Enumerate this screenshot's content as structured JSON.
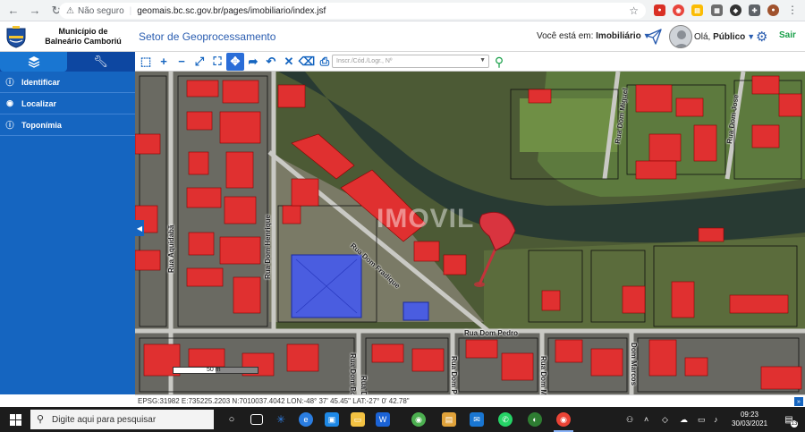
{
  "browser": {
    "security_label": "Não seguro",
    "url": "geomais.bc.sc.gov.br/pages/imobiliario/index.jsf"
  },
  "header": {
    "municipality_line1": "Município de",
    "municipality_line2": "Balneário Camboriú",
    "section_title": "Setor de Geoprocessamento",
    "voce_label": "Você está em:",
    "voce_value": "Imobiliário",
    "greeting_label": "Olá,",
    "greeting_user": "Público",
    "logout_label": "Sair"
  },
  "sidebar": {
    "tabs": [
      {
        "icon": "layers-icon"
      },
      {
        "icon": "wrench-icon"
      }
    ],
    "items": [
      {
        "label": "Identificar",
        "icon": "info-icon"
      },
      {
        "label": "Localizar",
        "icon": "map-pin-icon"
      },
      {
        "label": "Toponímia",
        "icon": "info-icon"
      }
    ]
  },
  "toolbar": {
    "search_placeholder": "Inscr./Cód./Logr., Nº"
  },
  "map": {
    "street_labels": [
      "Rua Dom Fradique",
      "Rua Dom Henrique",
      "Rua Aquidabã",
      "Rua Dom Pedro",
      "Rua Dom Miguel",
      "Rua Dom Jose",
      "Rua Dom Bos",
      "Rua Dom Bo",
      "Rua Dom Pe",
      "Rua Dom Ma",
      "Dom Marcos"
    ],
    "scale_label": "50 m",
    "watermark": "IMOVIL"
  },
  "statusbar": {
    "coords": "EPSG:31982 E:735225.2203 N:7010037.4042 LON:-48° 37' 45.45\" LAT:-27° 0' 42.78\""
  },
  "taskbar": {
    "search_placeholder": "Digite aqui para pesquisar",
    "time": "09:23",
    "date": "30/03/2021",
    "notification_count": "13"
  },
  "colors": {
    "sidebar": "#1565c0",
    "accent": "#2a5db0",
    "logout": "#1aa04a",
    "parcel_highlight": "#e03030",
    "selected_parcel": "#4a5de0"
  }
}
